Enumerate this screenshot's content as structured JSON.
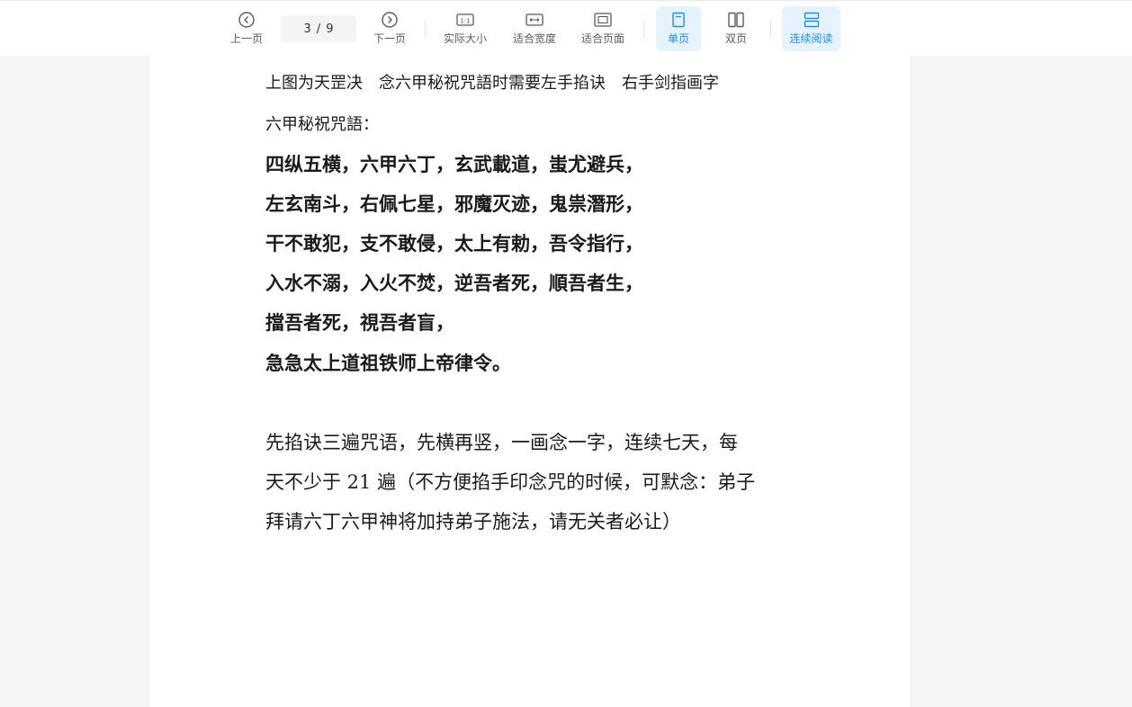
{
  "toolbar": {
    "prev_label": "上一页",
    "current_page": "3",
    "page_separator": "/",
    "total_pages": "9",
    "next_label": "下一页",
    "actual_size_label": "实际大小",
    "actual_size_icon_text": "1:1",
    "fit_width_label": "适合宽度",
    "fit_page_label": "适合页面",
    "single_page_label": "单页",
    "double_page_label": "双页",
    "continuous_label": "连续阅读",
    "active_modes": [
      "单页",
      "连续阅读"
    ],
    "accent_color": "#1a8fe6",
    "active_bg_color": "#e6f3ff",
    "icons": {
      "prev": "chevron-left-circle-icon",
      "next": "chevron-right-circle-icon",
      "actual_size": "actual-size-icon",
      "fit_width": "fit-width-icon",
      "fit_page": "fit-page-icon",
      "single_page": "single-page-icon",
      "double_page": "double-page-icon",
      "continuous": "continuous-read-icon"
    }
  },
  "document": {
    "lines": [
      "上图为天罡决　念六甲秘祝咒語时需要左手掐诀　右手剑指画字",
      "六甲秘祝咒語：",
      "四纵五横，六甲六丁，玄武載道，蚩尤避兵，",
      "左玄南斗，右佩七星，邪魔灭迹，鬼祟潛形，",
      "干不敢犯，支不敢侵，太上有勅，吾令指行，",
      "入水不溺，入火不焚，逆吾者死，順吾者生，",
      "擋吾者死，視吾者盲，",
      "急急太上道祖铁师上帝律令。",
      "先掐诀三遍咒语，先横再竖，一画念一字，连续七天，每",
      "天不少于 21 遍（不方便掐手印念咒的时候，可默念：弟子",
      "拜请六丁六甲神将加持弟子施法，请无关者必让）"
    ]
  }
}
